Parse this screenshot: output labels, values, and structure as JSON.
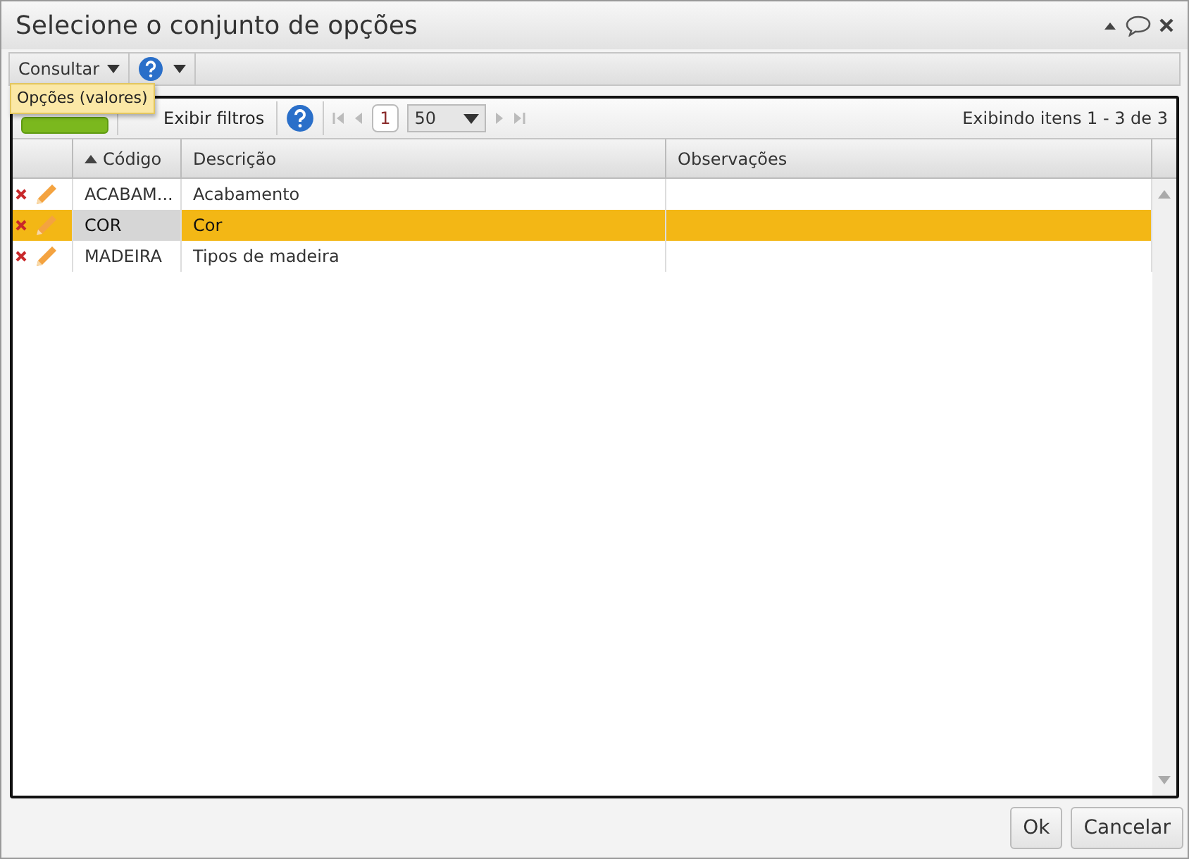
{
  "window": {
    "title": "Selecione o conjunto de opções"
  },
  "menubar": {
    "items": [
      {
        "kind": "text",
        "label": "Consultar",
        "expanded": true
      },
      {
        "kind": "help"
      }
    ]
  },
  "dropdown": {
    "items": [
      "Opções (valores)"
    ]
  },
  "toolbar": {
    "filters_button": "Exibir filtros",
    "page": "1",
    "page_size": "50",
    "status": "Exibindo itens 1 - 3 de 3"
  },
  "table": {
    "columns": [
      {
        "label": "Código",
        "sorted": true
      },
      {
        "label": "Descrição",
        "sorted": false
      },
      {
        "label": "Observações",
        "sorted": false
      }
    ],
    "rows": [
      {
        "cells": [
          "ACABAM...",
          "Acabamento",
          ""
        ],
        "selected": false
      },
      {
        "cells": [
          "COR",
          "Cor",
          ""
        ],
        "selected": true
      },
      {
        "cells": [
          "MADEIRA",
          "Tipos de madeira",
          ""
        ],
        "selected": false
      }
    ]
  },
  "buttons": [
    "Ok",
    "Cancelar"
  ]
}
